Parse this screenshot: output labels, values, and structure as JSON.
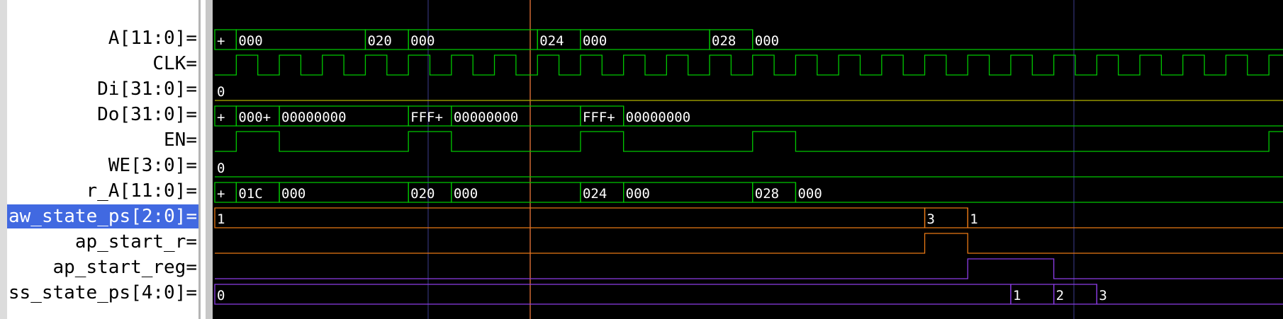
{
  "colors": {
    "green": "#00c800",
    "yellow": "#b4b400",
    "orange": "#e87814",
    "purple": "#8c3ce6",
    "cursor": "#ff8040",
    "marker": "#3c3c8c",
    "selection": "#4169e1"
  },
  "signals": [
    {
      "name": "A[11:0]=",
      "type": "bus",
      "color": "green",
      "segments": [
        {
          "start": 0,
          "label": "+"
        },
        {
          "start": 1,
          "label": "000"
        },
        {
          "start": 7,
          "label": "020"
        },
        {
          "start": 9,
          "label": "000"
        },
        {
          "start": 15,
          "label": "024"
        },
        {
          "start": 17,
          "label": "000"
        },
        {
          "start": 23,
          "label": "028"
        },
        {
          "start": 25,
          "label": "000"
        }
      ]
    },
    {
      "name": "CLK=",
      "type": "clock",
      "color": "green"
    },
    {
      "name": "Di[31:0]=",
      "type": "bus",
      "color": "yellow",
      "segments": [
        {
          "start": 0,
          "label": "0"
        }
      ]
    },
    {
      "name": "Do[31:0]=",
      "type": "bus",
      "color": "green",
      "segments": [
        {
          "start": 0,
          "label": "+"
        },
        {
          "start": 1,
          "label": "000+"
        },
        {
          "start": 3,
          "label": "00000000"
        },
        {
          "start": 9,
          "label": "FFF+"
        },
        {
          "start": 11,
          "label": "00000000"
        },
        {
          "start": 17,
          "label": "FFF+"
        },
        {
          "start": 19,
          "label": "00000000"
        }
      ]
    },
    {
      "name": "EN=",
      "type": "bit",
      "color": "green",
      "high": [
        [
          1,
          3
        ],
        [
          9,
          11
        ],
        [
          17,
          19
        ],
        [
          25,
          27
        ],
        [
          49,
          50
        ]
      ]
    },
    {
      "name": "WE[3:0]=",
      "type": "bus",
      "color": "green",
      "segments": [
        {
          "start": 0,
          "label": "0"
        }
      ]
    },
    {
      "name": "r_A[11:0]=",
      "type": "bus",
      "color": "green",
      "segments": [
        {
          "start": 0,
          "label": "+"
        },
        {
          "start": 1,
          "label": "01C"
        },
        {
          "start": 3,
          "label": "000"
        },
        {
          "start": 9,
          "label": "020"
        },
        {
          "start": 11,
          "label": "000"
        },
        {
          "start": 17,
          "label": "024"
        },
        {
          "start": 19,
          "label": "000"
        },
        {
          "start": 25,
          "label": "028"
        },
        {
          "start": 27,
          "label": "000"
        }
      ]
    },
    {
      "name": "aw_state_ps[2:0]=",
      "type": "bus",
      "color": "orange",
      "selected": true,
      "segments": [
        {
          "start": 0,
          "label": "1"
        },
        {
          "start": 33,
          "label": "3"
        },
        {
          "start": 35,
          "label": "1"
        }
      ]
    },
    {
      "name": "ap_start_r=",
      "type": "bit",
      "color": "orange",
      "high": [
        [
          33,
          35
        ]
      ]
    },
    {
      "name": "ap_start_reg=",
      "type": "bit",
      "color": "purple",
      "high": [
        [
          35,
          39
        ]
      ]
    },
    {
      "name": "ss_state_ps[4:0]=",
      "type": "bus",
      "color": "purple",
      "segments": [
        {
          "start": 0,
          "label": "0"
        },
        {
          "start": 37,
          "label": "1"
        },
        {
          "start": 39,
          "label": "2"
        },
        {
          "start": 41,
          "label": "3"
        }
      ]
    }
  ]
}
